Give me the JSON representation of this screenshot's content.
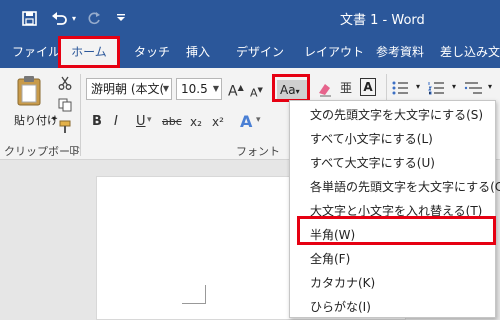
{
  "window": {
    "title": "文書 1 - Word"
  },
  "quick_access": {
    "save_icon": "save-icon",
    "undo_icon": "undo-icon",
    "redo_icon": "redo-icon",
    "customize_icon": "customize-qat-icon"
  },
  "tabs": [
    {
      "label": "ファイル"
    },
    {
      "label": "ホーム"
    },
    {
      "label": "タッチ"
    },
    {
      "label": "挿入"
    },
    {
      "label": "デザイン"
    },
    {
      "label": "レイアウト"
    },
    {
      "label": "参考資料"
    },
    {
      "label": "差し込み文"
    }
  ],
  "clipboard": {
    "paste_label": "貼り付け",
    "group_label": "クリップボード"
  },
  "font": {
    "name": "游明朝 (本文(",
    "size": "10.5",
    "group_label": "フォント",
    "bold": "B",
    "italic": "I",
    "underline": "U",
    "strike": "abc",
    "subscript": "x₂",
    "superscript": "x²",
    "grow": "A",
    "shrink": "A",
    "change_case": "Aa",
    "text_effect": "A",
    "char_border": "A"
  },
  "change_case_menu": {
    "items": [
      "文の先頭文字を大文字にする(S)",
      "すべて小文字にする(L)",
      "すべて大文字にする(U)",
      "各単語の先頭文字を大文字にする(C)",
      "大文字と小文字を入れ替える(T)",
      "半角(W)",
      "全角(F)",
      "カタカナ(K)",
      "ひらがな(I)"
    ],
    "highlighted": "半角(W)"
  },
  "colors": {
    "brand": "#2b579a",
    "highlight": "#e60012",
    "ribbon": "#f3f3f3"
  }
}
